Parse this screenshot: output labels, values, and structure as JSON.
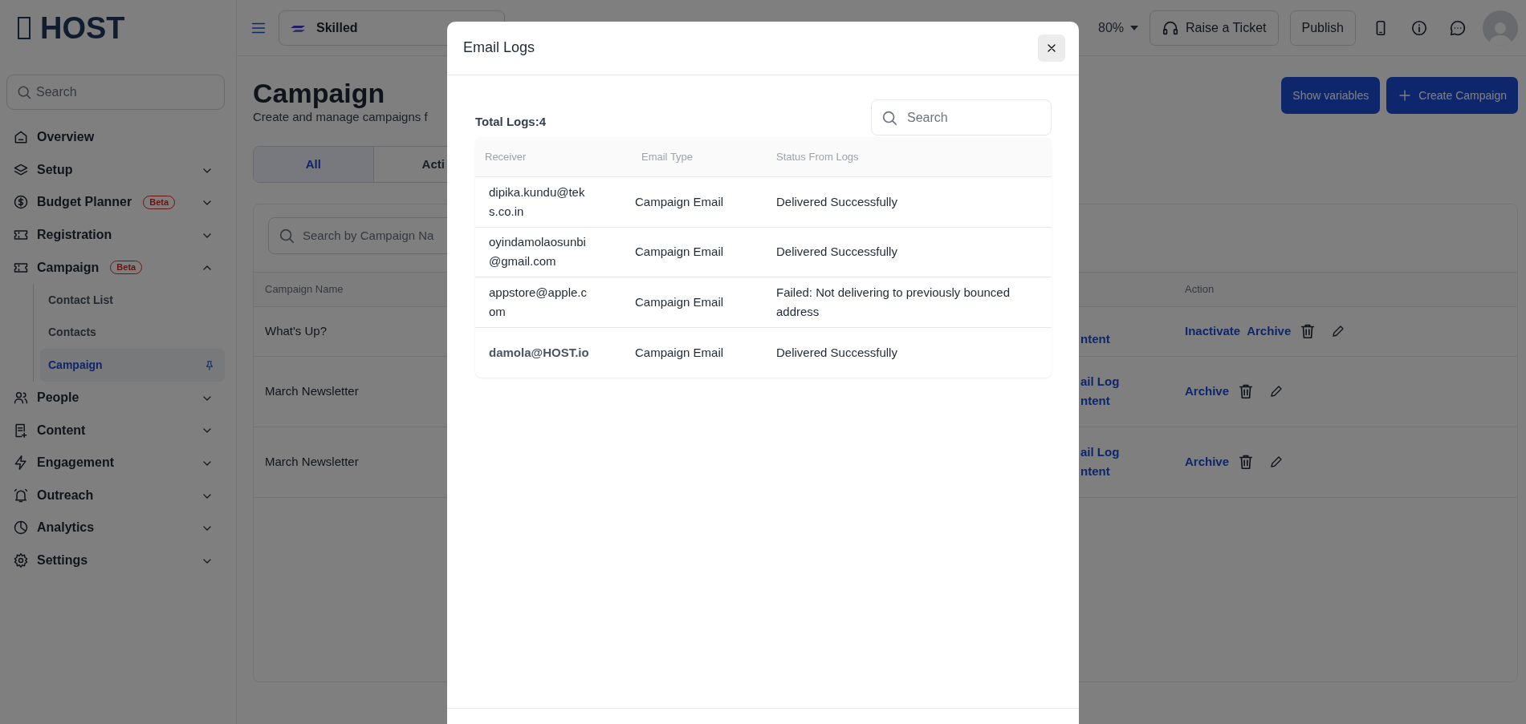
{
  "sidebar": {
    "logo": "HOST",
    "search_placeholder": "Search",
    "items": [
      {
        "label": "Overview"
      },
      {
        "label": "Setup",
        "expanded": false
      },
      {
        "label": "Budget Planner",
        "badge": "Beta",
        "expanded": false
      },
      {
        "label": "Registration",
        "expanded": false
      },
      {
        "label": "Campaign",
        "badge": "Beta",
        "expanded": true,
        "children": [
          {
            "label": "Contact List",
            "selected": false
          },
          {
            "label": "Contacts",
            "selected": false
          },
          {
            "label": "Campaign",
            "selected": true
          }
        ]
      },
      {
        "label": "People",
        "expanded": false
      },
      {
        "label": "Content",
        "expanded": false
      },
      {
        "label": "Engagement",
        "expanded": false
      },
      {
        "label": "Outreach",
        "expanded": false
      },
      {
        "label": "Analytics",
        "expanded": false
      },
      {
        "label": "Settings",
        "expanded": false
      }
    ]
  },
  "topbar": {
    "workspace": "Skilled",
    "zoom": "80%",
    "buttons": [
      "Raise a Ticket",
      "Publish"
    ]
  },
  "page": {
    "title": "Campaign",
    "subtitle": "Create and manage campaigns f",
    "actions": [
      "Show variables",
      "Create Campaign"
    ],
    "tabs": [
      {
        "label": "All",
        "selected": true
      },
      {
        "label": "Acti",
        "selected": false
      }
    ],
    "search_placeholder": "Search by Campaign Na",
    "table": {
      "columns": [
        "Campaign Name",
        "Action"
      ],
      "rows": [
        {
          "name": "What's Up?",
          "links": [
            "ntent"
          ],
          "actions": [
            "Inactivate",
            "Archive"
          ]
        },
        {
          "name": "March Newsletter",
          "links": [
            "ail Log",
            "ntent"
          ],
          "actions": [
            "Archive"
          ]
        },
        {
          "name": "March Newsletter",
          "links": [
            "ail Log",
            "ntent"
          ],
          "actions": [
            "Archive"
          ]
        }
      ]
    }
  },
  "modal": {
    "title": "Email Logs",
    "total": "Total Logs:4",
    "search_placeholder": "Search",
    "columns": [
      "Receiver",
      "Email Type",
      "Status From Logs"
    ],
    "rows": [
      {
        "receiver": "dipika.kundu@teks.co.in",
        "type": "Campaign Email",
        "status": "Delivered Successfully"
      },
      {
        "receiver": "oyindamolaosunbi@gmail.com",
        "type": "Campaign Email",
        "status": "Delivered Successfully"
      },
      {
        "receiver": "appstore@apple.com",
        "type": "Campaign Email",
        "status": "Failed: Not delivering to previously bounced address"
      },
      {
        "receiver": "damola@HOST.io",
        "type": "Campaign Email",
        "status": "Delivered Successfully"
      }
    ]
  }
}
